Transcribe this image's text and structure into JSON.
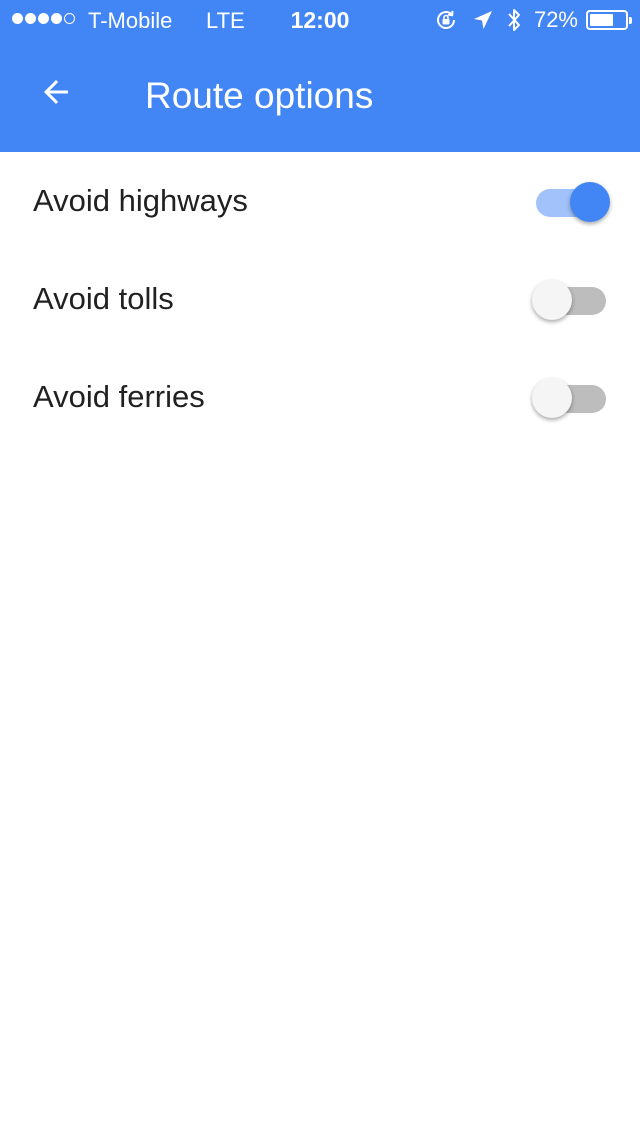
{
  "status_bar": {
    "signal_filled": 4,
    "signal_total": 5,
    "carrier": "T-Mobile",
    "network": "LTE",
    "time": "12:00",
    "battery_percent_label": "72%",
    "battery_level": 0.72,
    "icons": [
      "rotation-lock-icon",
      "location-arrow-icon",
      "bluetooth-icon",
      "battery-icon"
    ]
  },
  "toolbar": {
    "back_icon": "arrow-back-icon",
    "title": "Route options"
  },
  "settings": [
    {
      "label": "Avoid highways",
      "enabled": true
    },
    {
      "label": "Avoid tolls",
      "enabled": false
    },
    {
      "label": "Avoid ferries",
      "enabled": false
    }
  ],
  "colors": {
    "primary": "#4285f4",
    "toggle_on_track": "#a1c2fa",
    "toggle_off_track": "#bdbdbd",
    "toggle_off_thumb": "#f5f5f5",
    "text": "#212121"
  }
}
